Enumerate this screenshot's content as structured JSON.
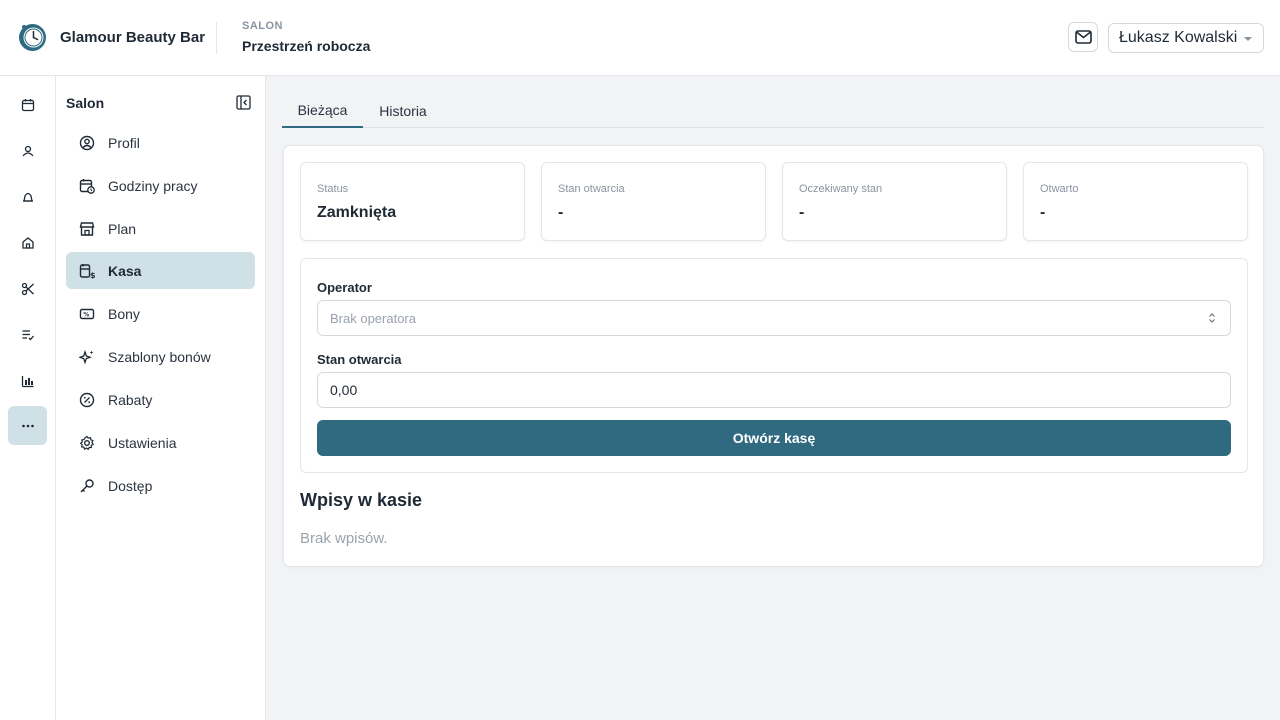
{
  "header": {
    "brand": "Glamour Beauty Bar",
    "section": "SALON",
    "title": "Przestrzeń robocza",
    "user": "Łukasz Kowalski"
  },
  "rail": {
    "icons": [
      "calendar-icon",
      "users-icon",
      "bell-icon",
      "home-icon",
      "scissors-icon",
      "checklist-icon",
      "bar-chart-icon",
      "more-icon"
    ],
    "active": "more-icon"
  },
  "sidebar": {
    "title": "Salon",
    "items": [
      {
        "label": "Profil",
        "icon": "user-circle-icon"
      },
      {
        "label": "Godziny pracy",
        "icon": "calendar-clock-icon"
      },
      {
        "label": "Plan",
        "icon": "store-icon"
      },
      {
        "label": "Kasa",
        "icon": "cash-register-icon",
        "active": true
      },
      {
        "label": "Bony",
        "icon": "voucher-icon"
      },
      {
        "label": "Szablony bonów",
        "icon": "sparkles-icon"
      },
      {
        "label": "Rabaty",
        "icon": "discount-icon"
      },
      {
        "label": "Ustawienia",
        "icon": "gear-icon"
      },
      {
        "label": "Dostęp",
        "icon": "key-icon"
      }
    ]
  },
  "tabs": [
    {
      "label": "Bieżąca",
      "active": true
    },
    {
      "label": "Historia",
      "active": false
    }
  ],
  "stats": [
    {
      "label": "Status",
      "value": "Zamknięta"
    },
    {
      "label": "Stan otwarcia",
      "value": "-"
    },
    {
      "label": "Oczekiwany stan",
      "value": "-"
    },
    {
      "label": "Otwarto",
      "value": "-"
    }
  ],
  "form": {
    "operator_label": "Operator",
    "operator_placeholder": "Brak operatora",
    "opening_label": "Stan otwarcia",
    "opening_value": "0,00",
    "submit_label": "Otwórz kasę"
  },
  "entries": {
    "title": "Wpisy w kasie",
    "empty": "Brak wpisów."
  },
  "colors": {
    "accent": "#2f6a80",
    "active_bg": "#cfe0e6"
  }
}
